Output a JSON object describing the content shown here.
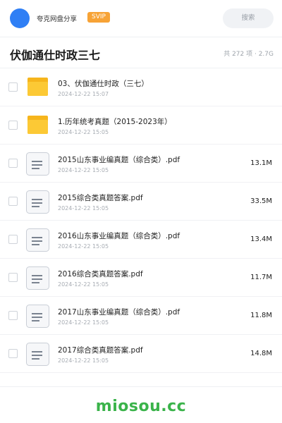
{
  "header": {
    "user_name": "夸克网盘分享",
    "badge": "SVIP",
    "search_placeholder": "搜索",
    "avatar_color": "#2f7ff5",
    "badge_color": "#f7a336"
  },
  "folder": {
    "title": "伏伽通仕时政三七",
    "meta": "共 272 项 · 2.7G"
  },
  "items": [
    {
      "type": "folder",
      "icon": "folder-icon",
      "name": "03、伏伽通仕时政（三七）",
      "date": "2024-12-22 15:07",
      "size": ""
    },
    {
      "type": "folder",
      "icon": "folder-icon",
      "name": "1.历年统考真题（2015-2023年）",
      "date": "2024-12-22 15:05",
      "size": ""
    },
    {
      "type": "file",
      "icon": "document-icon",
      "name": "2015山东事业编真题（综合类）.pdf",
      "date": "2024-12-22 15:05",
      "size": "13.1M"
    },
    {
      "type": "file",
      "icon": "document-icon",
      "name": "2015综合类真题答案.pdf",
      "date": "2024-12-22 15:05",
      "size": "33.5M"
    },
    {
      "type": "file",
      "icon": "document-icon",
      "name": "2016山东事业编真题（综合类）.pdf",
      "date": "2024-12-22 15:05",
      "size": "13.4M"
    },
    {
      "type": "file",
      "icon": "document-icon",
      "name": "2016综合类真题答案.pdf",
      "date": "2024-12-22 15:05",
      "size": "11.7M"
    },
    {
      "type": "file",
      "icon": "document-icon",
      "name": "2017山东事业编真题（综合类）.pdf",
      "date": "2024-12-22 15:05",
      "size": "11.8M"
    },
    {
      "type": "file",
      "icon": "document-icon",
      "name": "2017综合类真题答案.pdf",
      "date": "2024-12-22 15:05",
      "size": "14.8M"
    }
  ],
  "watermark": "miosou.cc",
  "colors": {
    "folder_yellow": "#fbc02d",
    "watermark_green": "#3ab34a"
  }
}
